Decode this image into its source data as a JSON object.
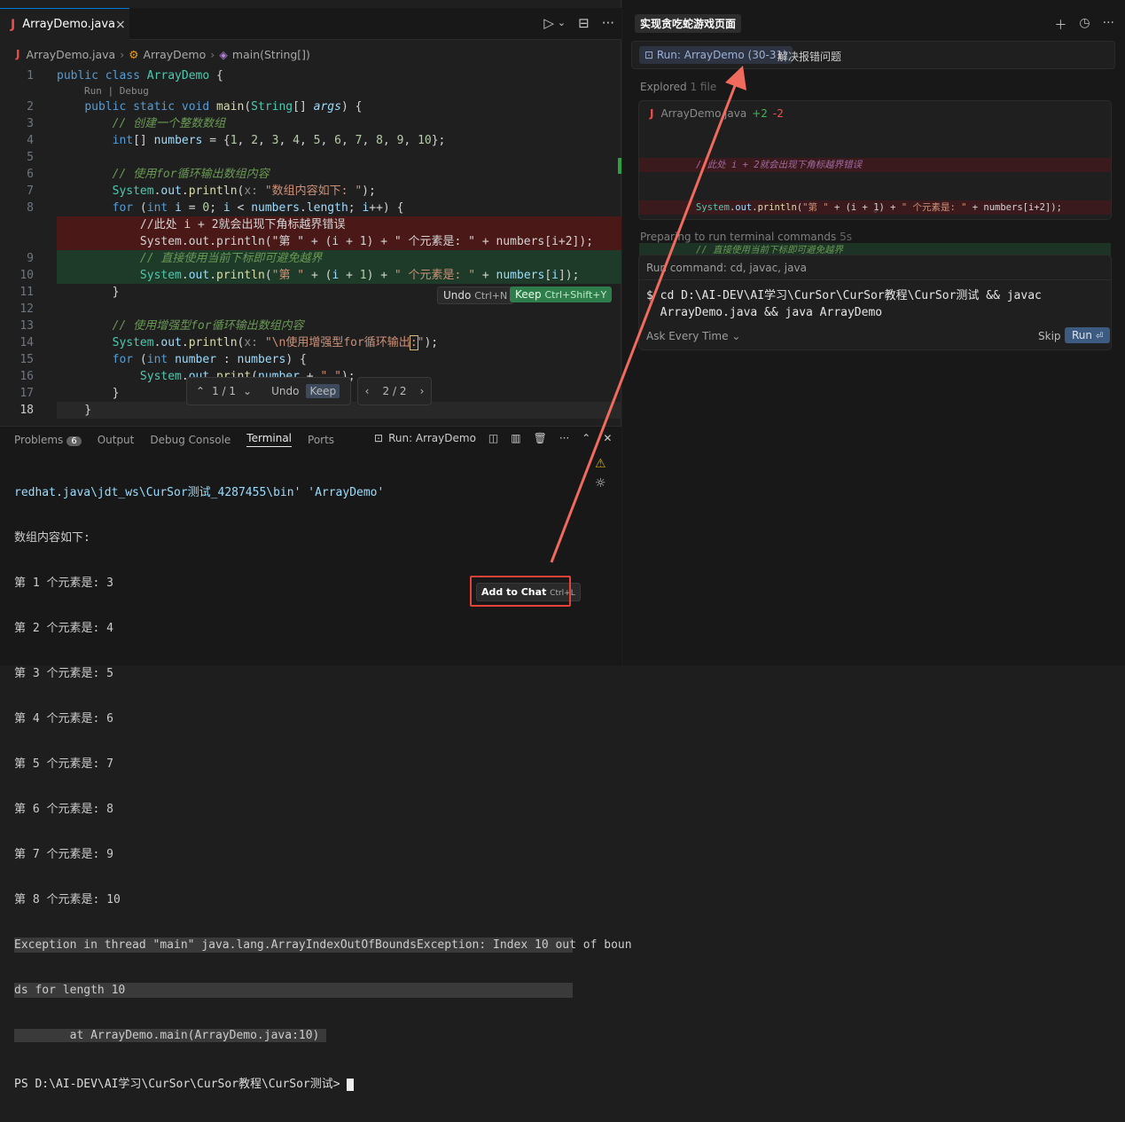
{
  "editor": {
    "tab": {
      "icon": "J",
      "filename": "ArrayDemo.java",
      "close": "×"
    },
    "actions": {
      "run": "▷",
      "run_menu": "⌄",
      "split": "⊟",
      "more": "···"
    },
    "breadcrumb": {
      "file": "ArrayDemo.java",
      "class": "ArrayDemo",
      "method": "main(String[])"
    },
    "codelens": "Run | Debug",
    "lines": [
      {
        "n": "1"
      },
      {
        "n": "2"
      },
      {
        "n": "3"
      },
      {
        "n": "4"
      },
      {
        "n": "5"
      },
      {
        "n": "6"
      },
      {
        "n": "7"
      },
      {
        "n": "8"
      },
      {
        "n": "9"
      },
      {
        "n": "10"
      },
      {
        "n": "11"
      },
      {
        "n": "12"
      },
      {
        "n": "13"
      },
      {
        "n": "14"
      },
      {
        "n": "15"
      },
      {
        "n": "16"
      },
      {
        "n": "17"
      },
      {
        "n": "18"
      }
    ],
    "inline_actions": {
      "undo": "Undo",
      "undo_key": "Ctrl+N",
      "keep": "Keep",
      "keep_key": "Ctrl+Shift+Y"
    },
    "diff_nav": {
      "counter": "1 / 1",
      "undo": "Undo",
      "keep": "Keep",
      "file_counter": "2 / 2"
    }
  },
  "panel": {
    "tabs": {
      "problems": "Problems",
      "problems_count": "6",
      "output": "Output",
      "debug": "Debug Console",
      "terminal": "Terminal",
      "ports": "Ports"
    },
    "run_label": "Run: ArrayDemo",
    "terminal_lines": [
      "redhat.java\\jdt_ws\\CurSor测试_4287455\\bin' 'ArrayDemo'",
      "数组内容如下:",
      "第 1 个元素是: 3",
      "第 2 个元素是: 4",
      "第 3 个元素是: 5",
      "第 4 个元素是: 6",
      "第 5 个元素是: 7",
      "第 6 个元素是: 8",
      "第 7 个元素是: 9",
      "第 8 个元素是: 10"
    ],
    "error_lines": [
      "Exception in thread \"main\" java.lang.ArrayIndexOutOfBoundsException: Index 10 out of boun",
      "ds for length 10",
      "        at ArrayDemo.main(ArrayDemo.java:10) "
    ],
    "prompt": "PS D:\\AI-DEV\\AI学习\\CurSor\\CurSor教程\\CurSor测试> ",
    "add_to_chat": "Add to Chat",
    "add_to_chat_key": "Ctrl+L"
  },
  "chat": {
    "title": "实现贪吃蛇游戏页面",
    "context_pill": "Run: ArrayDemo (30-31)",
    "context_text": "解决报错问题",
    "explored": "Explored",
    "explored_count": "1 file",
    "diff_file": "ArrayDemo.java",
    "diff_add": "+2",
    "diff_del": "-2",
    "preparing": "Preparing to run terminal commands",
    "preparing_time": "5s",
    "run_command_label": "Run command: cd, javac, java",
    "command": "cd D:\\AI-DEV\\AI学习\\CurSor\\CurSor教程\\CurSor测试 && javac\nArrayDemo.java && java ArrayDemo",
    "ask_mode": "Ask Every Time",
    "skip": "Skip",
    "run": "Run"
  }
}
